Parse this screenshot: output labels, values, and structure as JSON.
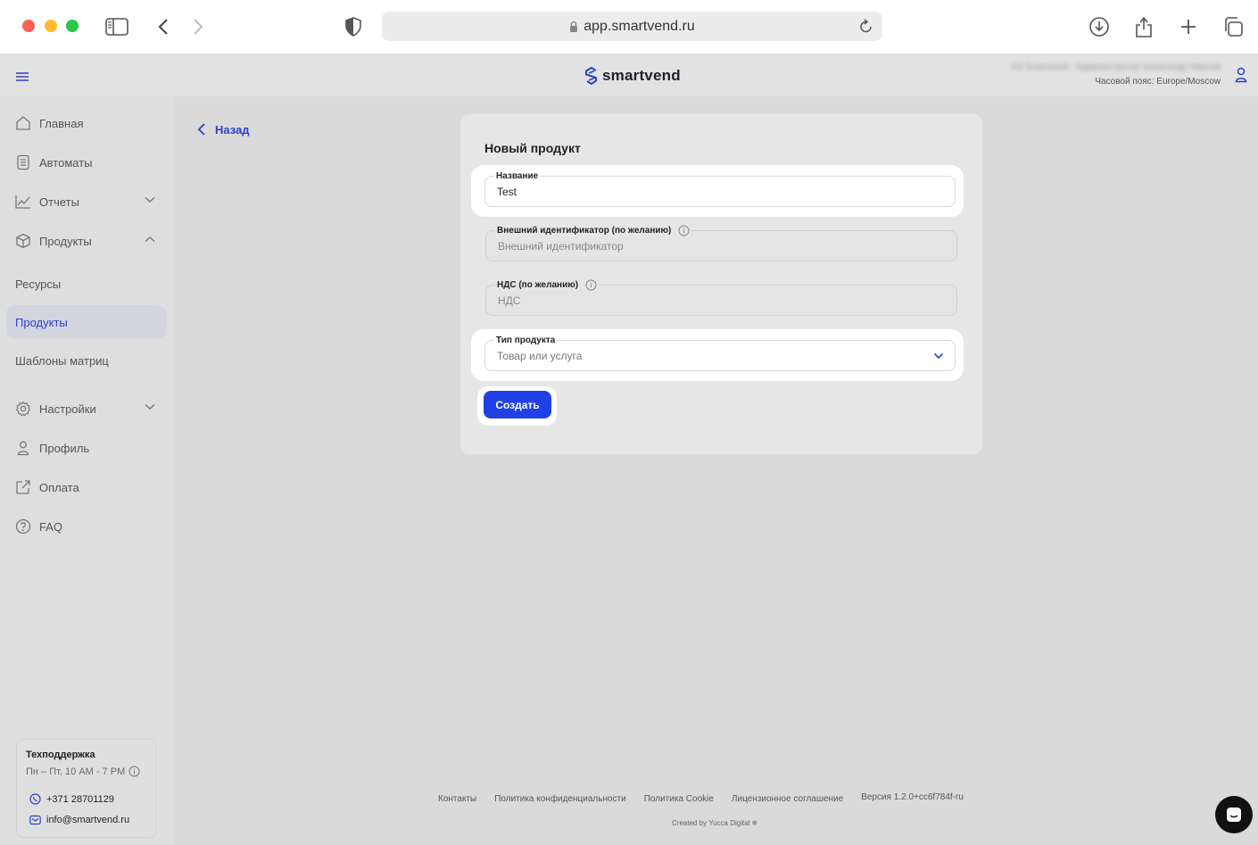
{
  "browser": {
    "url": "app.smartvend.ru"
  },
  "header": {
    "logo_text": "smartvend",
    "user_name": "SA Smartvend · Администратор Александр Иванов",
    "timezone": "Часовой пояс: Europe/Moscow"
  },
  "sidebar": {
    "items": [
      {
        "label": "Главная",
        "icon": "home-icon"
      },
      {
        "label": "Автоматы",
        "icon": "vending-machine-icon"
      },
      {
        "label": "Отчеты",
        "icon": "chart-icon"
      },
      {
        "label": "Продукты",
        "icon": "box-icon"
      }
    ],
    "sub_items": [
      {
        "label": "Ресурсы"
      },
      {
        "label": "Продукты",
        "active": true
      },
      {
        "label": "Шаблоны матриц"
      }
    ],
    "bottom_items": [
      {
        "label": "Настройки",
        "icon": "gear-icon"
      },
      {
        "label": "Профиль",
        "icon": "user-icon"
      },
      {
        "label": "Оплата",
        "icon": "external-link-icon"
      },
      {
        "label": "FAQ",
        "icon": "help-icon"
      }
    ],
    "support": {
      "title": "Техподдержка",
      "hours": "Пн – Пт, 10 AM - 7 PM",
      "phone": "+371 28701129",
      "email": "info@smartvend.ru"
    }
  },
  "main": {
    "back_label": "Назад",
    "form": {
      "title": "Новый продукт",
      "name_label": "Название",
      "name_value": "Test",
      "external_id_label": "Внешний идентификатор (по желанию)",
      "external_id_placeholder": "Внешний идентификатор",
      "vat_label": "НДС (по желанию)",
      "vat_placeholder": "НДС",
      "type_label": "Тип продукта",
      "type_value": "Товар или услуга",
      "submit_label": "Создать"
    }
  },
  "footer": {
    "links": [
      "Контакты",
      "Политика конфиденциальности",
      "Политика Cookie",
      "Лицензионное соглашение"
    ],
    "version": "Версия 1.2.0+cc6f784f-ru",
    "credit": "Created by Yucca Digital ❄"
  },
  "colors": {
    "accent": "#1f40e6",
    "active_nav_bg": "#d3d5df",
    "active_nav_text": "#2943c8"
  }
}
